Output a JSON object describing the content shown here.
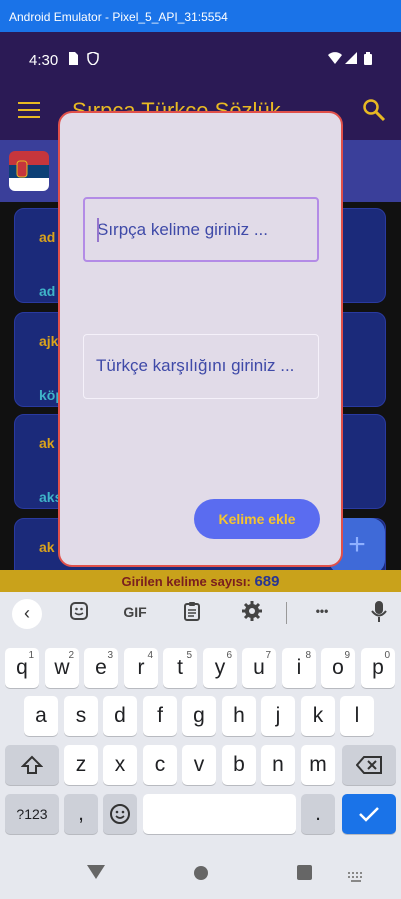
{
  "window": {
    "title": "Android Emulator - Pixel_5_API_31:5554"
  },
  "status": {
    "time": "4:30"
  },
  "appbar": {
    "title": "Sırpça Türkçe Sözlük"
  },
  "list": {
    "cards": [
      {
        "word": "ad",
        "meaning": "ad"
      },
      {
        "word": "ajk",
        "meaning": "köp"
      },
      {
        "word": "ak",
        "meaning": "aks"
      },
      {
        "word": "ak",
        "meaning": ""
      }
    ]
  },
  "counter": {
    "label": "Girilen kelime sayısı:",
    "value": "689"
  },
  "dialog": {
    "serbian_placeholder": "Sırpça kelime giriniz ...",
    "turkish_placeholder": "Türkçe karşılığını giriniz ...",
    "add_label": "Kelime ekle"
  },
  "fab": {
    "label": "+"
  },
  "keyboard": {
    "toolbar": {
      "gif_label": "GIF",
      "more_label": "•••"
    },
    "row1": [
      "q",
      "w",
      "e",
      "r",
      "t",
      "y",
      "u",
      "i",
      "o",
      "p"
    ],
    "row1_digits": [
      "1",
      "2",
      "3",
      "4",
      "5",
      "6",
      "7",
      "8",
      "9",
      "0"
    ],
    "row2": [
      "a",
      "s",
      "d",
      "f",
      "g",
      "h",
      "j",
      "k",
      "l"
    ],
    "row3": [
      "z",
      "x",
      "c",
      "v",
      "b",
      "n",
      "m"
    ],
    "symbols_label": "?123",
    "comma": ",",
    "period": "."
  },
  "colors": {
    "accent": "#e8b923",
    "appbar": "#2b1a55",
    "dialog": "#e1dbe8",
    "dialog_border": "#e0504a",
    "button": "#5a6cf0"
  },
  "icons": [
    "menu-icon",
    "search-icon",
    "serbia-flag",
    "back-icon",
    "sticker-icon",
    "gif-icon",
    "clipboard-icon",
    "gear-icon",
    "more-icon",
    "mic-icon",
    "shift-icon",
    "backspace-icon",
    "emoji-icon",
    "enter-check-icon",
    "nav-back-icon",
    "nav-home-icon",
    "nav-recents-icon",
    "keyboard-switch-icon"
  ]
}
